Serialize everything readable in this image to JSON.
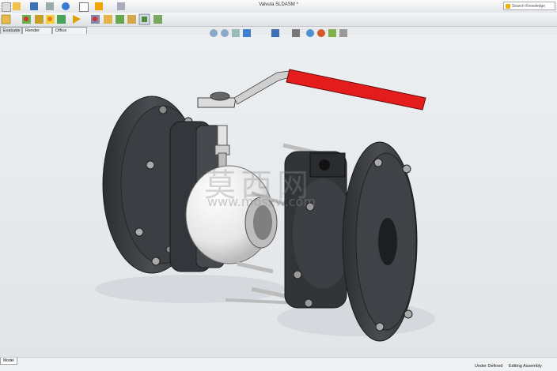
{
  "window": {
    "title": "Valvula SLDASM *"
  },
  "search": {
    "placeholder": "Search Knowledge Base"
  },
  "tabs": [
    "Evaluate",
    "Render Tools",
    "Office Products"
  ],
  "model_tab": "Model",
  "status": {
    "definition": "Under Defined",
    "mode": "Editing Assembly"
  },
  "watermark": {
    "text": "莫西网",
    "url": "www.mosxw.com"
  },
  "colors": {
    "handle": "#e41c1c",
    "body": "#3d3f42",
    "ball": "#f2f2f2",
    "viewport": "#e7eaed"
  },
  "icons": {
    "title_toolbar": [
      "new-icon",
      "open-icon",
      "save-icon",
      "print-icon",
      "undo-icon",
      "select-icon",
      "rebuild-icon",
      "options-icon"
    ],
    "feature_toolbar": [
      "insert-component-icon",
      "mate-icon",
      "linear-pattern-icon",
      "smart-fastener-icon",
      "move-component-icon",
      "show-hidden-icon",
      "assembly-features-icon",
      "reference-geometry-icon",
      "new-motion-study-icon",
      "bill-of-materials-icon",
      "exploded-view-icon",
      "instant3d-icon"
    ],
    "heads_up": [
      "zoom-to-fit-icon",
      "zoom-area-icon",
      "previous-view-icon",
      "section-view-icon",
      "view-orientation-icon",
      "display-style-icon",
      "hide-show-icon",
      "edit-appearance-icon",
      "apply-scene-icon",
      "view-settings-icon"
    ]
  }
}
